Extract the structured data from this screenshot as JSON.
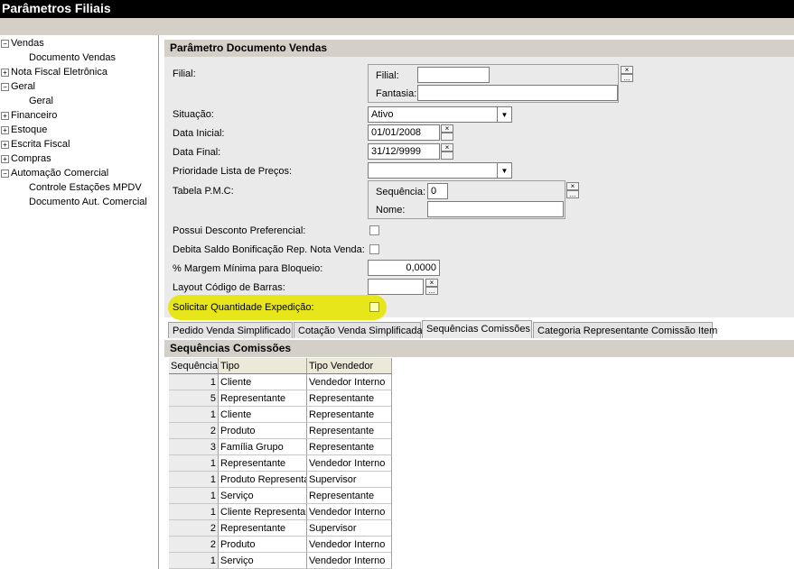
{
  "window": {
    "title": "Parâmetros Filiais"
  },
  "tree": {
    "items": [
      {
        "label": "Vendas",
        "expander": "−"
      },
      {
        "label": "Documento Vendas",
        "expander": ""
      },
      {
        "label": "Nota Fiscal Eletrônica",
        "expander": "+"
      },
      {
        "label": "Geral",
        "expander": "−"
      },
      {
        "label": "Geral",
        "expander": ""
      },
      {
        "label": "Financeiro",
        "expander": "+"
      },
      {
        "label": "Estoque",
        "expander": "+"
      },
      {
        "label": "Escrita Fiscal",
        "expander": "+"
      },
      {
        "label": "Compras",
        "expander": "+"
      },
      {
        "label": "Automação Comercial",
        "expander": "−"
      },
      {
        "label": "Controle Estações MPDV",
        "expander": ""
      },
      {
        "label": "Documento Aut. Comercial",
        "expander": ""
      }
    ]
  },
  "form": {
    "header": "Parâmetro Documento Vendas",
    "filial_label": "Filial:",
    "filial_inner_label": "Filial:",
    "fantasia_label": "Fantasia:",
    "filial_value": "",
    "fantasia_value": "",
    "situacao_label": "Situação:",
    "situacao_value": "Ativo",
    "data_inicial_label": "Data Inicial:",
    "data_inicial_value": "01/01/2008",
    "data_final_label": "Data Final:",
    "data_final_value": "31/12/9999",
    "prioridade_label": "Prioridade Lista de Preços:",
    "prioridade_value": "",
    "tabela_pmc_label": "Tabela P.M.C:",
    "sequencia_label": "Sequência:",
    "sequencia_value": "0",
    "nome_label": "Nome:",
    "nome_value": "",
    "desconto_label": "Possui Desconto Preferencial:",
    "debita_label": "Debita Saldo Bonificação Rep. Nota Venda:",
    "margem_label": "% Margem Mínima para Bloqueio:",
    "margem_value": "0,0000",
    "layout_label": "Layout Código de Barras:",
    "layout_value": "",
    "solicitar_label": "Solicitar Quantidade Expedição:",
    "clear_glyph": "×",
    "browse_glyph": "...",
    "dropdown_glyph": "▼",
    "highlight_color": "#e6e61a"
  },
  "tabs": [
    {
      "label": "Pedido Venda Simplificado"
    },
    {
      "label": "Cotação Venda Simplificada"
    },
    {
      "label": "Sequências Comissões"
    },
    {
      "label": "Categoria Representante Comissão Item"
    }
  ],
  "active_tab": "Sequências Comissões",
  "grid": {
    "title": "Sequências Comissões",
    "columns": [
      "Sequência",
      "Tipo",
      "Tipo Vendedor"
    ],
    "rows": [
      [
        "1",
        "Cliente",
        "Vendedor Interno"
      ],
      [
        "5",
        "Representante",
        "Representante"
      ],
      [
        "1",
        "Cliente",
        "Representante"
      ],
      [
        "2",
        "Produto",
        "Representante"
      ],
      [
        "3",
        "Família Grupo",
        "Representante"
      ],
      [
        "1",
        "Representante",
        "Vendedor Interno"
      ],
      [
        "1",
        "Produto Representante",
        "Supervisor"
      ],
      [
        "1",
        "Serviço",
        "Representante"
      ],
      [
        "1",
        "Cliente Representante",
        "Vendedor Interno"
      ],
      [
        "2",
        "Representante",
        "Supervisor"
      ],
      [
        "2",
        "Produto",
        "Vendedor Interno"
      ],
      [
        "1",
        "Serviço",
        "Vendedor Interno"
      ]
    ]
  }
}
